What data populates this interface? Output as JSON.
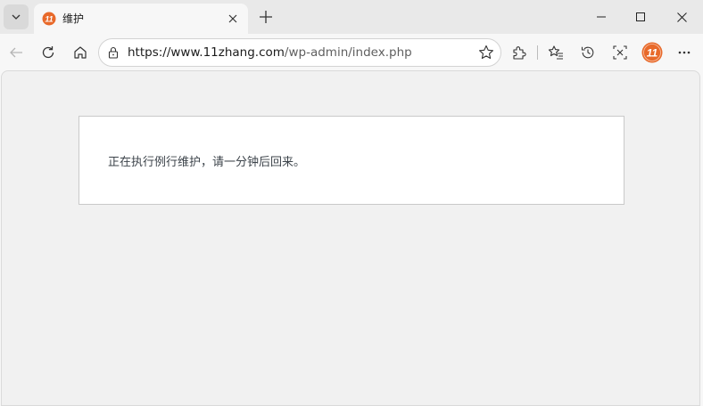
{
  "tab": {
    "title": "维护",
    "favicon_text": "11",
    "favicon_color": "#e8692a"
  },
  "address_bar": {
    "url_host": "https://www.11zhang.com",
    "url_path": "/wp-admin/index.php"
  },
  "profile": {
    "avatar_text": "11",
    "avatar_color": "#e8692a"
  },
  "page": {
    "message": "正在执行例行维护，请一分钟后回来。"
  },
  "colors": {
    "viewport_bg": "#f1f1f1",
    "message_box_bg": "#ffffff",
    "text": "#3c434a"
  }
}
